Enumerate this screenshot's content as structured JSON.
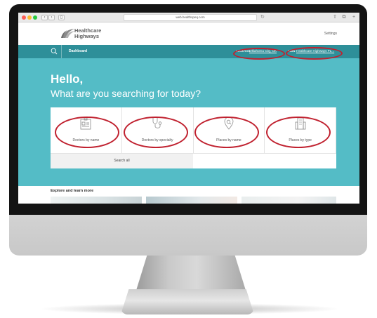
{
  "browser": {
    "url": "web.healthspeq.com",
    "back_glyph": "‹",
    "forward_glyph": "›",
    "sidebar_glyph": "▯",
    "reload_glyph": "↻",
    "share_glyph": "⇧",
    "tabs_glyph": "⧉",
    "new_tab_glyph": "+"
  },
  "header": {
    "logo_line1": "Healthcare",
    "logo_line2": "Highways",
    "settings": "Settings"
  },
  "navbar": {
    "dashboard": "Dashboard",
    "location_label": "LOCATION",
    "location_value": "Oklahoma City, OK",
    "plan_label": "PLAN",
    "plan_value": "Healthcare Highways PL..."
  },
  "hero": {
    "greeting": "Hello,",
    "question": "What are you searching for today?"
  },
  "search_options": [
    {
      "label": "Doctors by name",
      "icon": "id-card-icon"
    },
    {
      "label": "Doctors by specialty",
      "icon": "stethoscope-icon"
    },
    {
      "label": "Places by name",
      "icon": "map-pin-icon"
    },
    {
      "label": "Places by type",
      "icon": "building-icon"
    }
  ],
  "search_all": "Search all",
  "explore": {
    "title": "Explore and learn more"
  },
  "colors": {
    "teal_nav": "#2e8f99",
    "teal_hero": "#54bcc6",
    "annotation_red": "#c0212f"
  }
}
